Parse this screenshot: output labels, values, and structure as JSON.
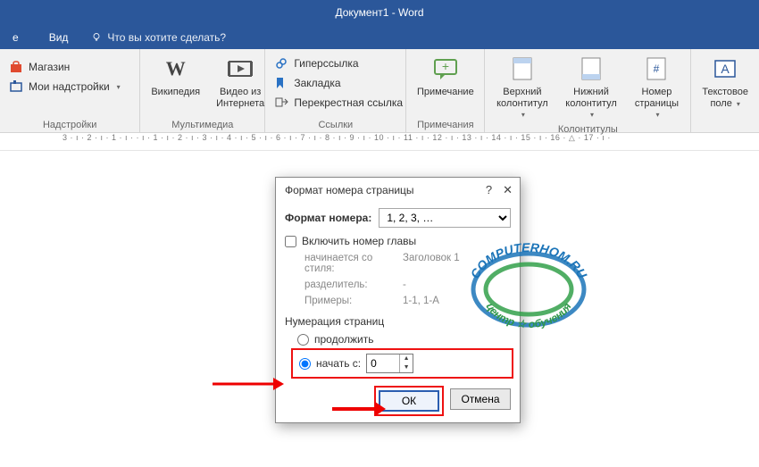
{
  "title": "Документ1 - Word",
  "tabs": {
    "view_tab": "Вид",
    "partial_tab": "е"
  },
  "tellme": "Что вы хотите сделать?",
  "ribbon": {
    "addins": {
      "label": "Надстройки",
      "store": "Магазин",
      "myaddins": "Мои надстройки"
    },
    "media": {
      "label": "Мультимедиа",
      "wikipedia": "Википедия",
      "onlinevideo_l1": "Видео из",
      "onlinevideo_l2": "Интернета"
    },
    "links": {
      "label": "Ссылки",
      "hyperlink": "Гиперссылка",
      "bookmark": "Закладка",
      "crossref": "Перекрестная ссылка"
    },
    "comments": {
      "label": "Примечания",
      "comment": "Примечание"
    },
    "headerfooter": {
      "label": "Колонтитулы",
      "header_l1": "Верхний",
      "header_l2": "колонтитул",
      "footer_l1": "Нижний",
      "footer_l2": "колонтитул",
      "pagenum_l1": "Номер",
      "pagenum_l2": "страницы"
    },
    "text": {
      "textbox_l1": "Текстовое",
      "textbox_l2": "поле"
    }
  },
  "ruler": "3 · ı · 2 · ı · 1 · ı ·   · ı · 1 · ı · 2 · ı · 3 · ı · 4 · ı · 5 · ı · 6 · ı · 7 · ı · 8 · ı · 9 · ı · 10 · ı · 11 · ı · 12 · ı · 13 · ı · 14 · ı · 15 · ı · 16 · △ · 17 · ı ·",
  "dialog": {
    "title": "Формат номера страницы",
    "format_label": "Формат номера:",
    "format_value": "1, 2, 3, …",
    "include_chapter": "Включить номер главы",
    "starts_style_lbl": "начинается со стиля:",
    "starts_style_val": "Заголовок 1",
    "separator_lbl": "разделитель:",
    "separator_val": "-",
    "examples_lbl": "Примеры:",
    "examples_val": "1-1, 1-A",
    "numbering": "Нумерация страниц",
    "continue": "продолжить",
    "start_at": "начать с:",
    "start_value": "0",
    "ok": "ОК",
    "cancel": "Отмена"
  },
  "stamp": {
    "top": "COMPUTERHOM.RU",
    "bottom": "центр ☆ обучения"
  }
}
